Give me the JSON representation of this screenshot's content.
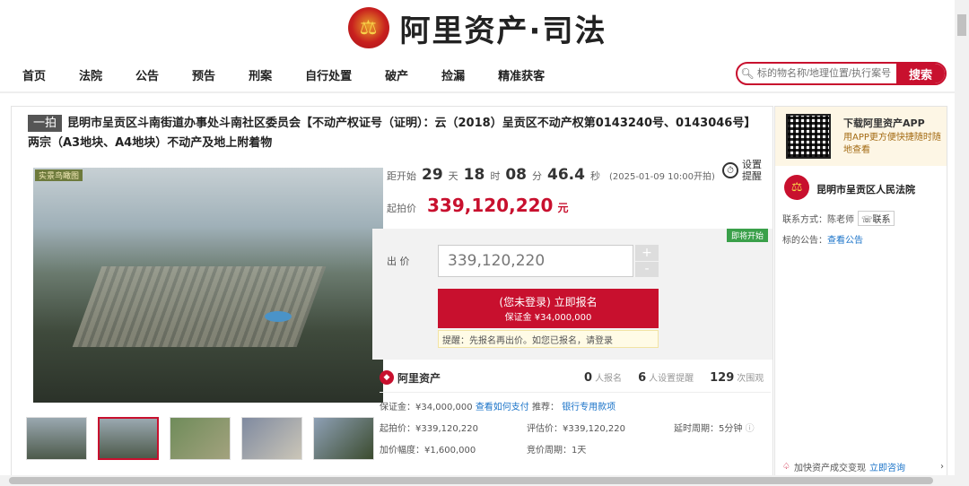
{
  "header": {
    "brand_icon": "scales-of-justice-emblem-icon",
    "brand_title": "阿里资产·司法"
  },
  "nav": {
    "items": [
      "首页",
      "法院",
      "公告",
      "预告",
      "刑案",
      "自行处置",
      "破产",
      "捡漏",
      "精准获客"
    ]
  },
  "search": {
    "placeholder": "标的物名称/地理位置/执行案号",
    "button_label": "搜索"
  },
  "item": {
    "tag": "一拍",
    "title": "昆明市呈贡区斗南街道办事处斗南社区委员会【不动产权证号（证明）：云（2018）呈贡区不动产权第0143240号、0143046号】两宗（A3地块、A4地块）不动产及地上附着物",
    "image_label": "实景鸟瞰图"
  },
  "countdown": {
    "label": "距开始",
    "days": "29",
    "days_unit": "天",
    "hours": "18",
    "hours_unit": "时",
    "minutes": "08",
    "minutes_unit": "分",
    "seconds": "46.4",
    "seconds_unit": "秒",
    "start_date": "(2025-01-09 10:00开拍)"
  },
  "reminder": {
    "label": "设置提醒"
  },
  "price": {
    "label": "起拍价",
    "value": "339,120,220",
    "unit": "元"
  },
  "bid": {
    "badge": "即将开始",
    "label": "出 价",
    "value": "339,120,220",
    "plus": "+",
    "minus": "-",
    "signup_main": "(您未登录) 立即报名",
    "signup_sub": "保证金 ¥34,000,000",
    "tip": "提醒：先报名再出价。如您已报名，请登录"
  },
  "stats": {
    "brand": "阿里资产",
    "signups": "0",
    "signups_label": "人报名",
    "reminders": "6",
    "reminders_label": "人设置提醒",
    "views": "129",
    "views_label": "次围观"
  },
  "details": {
    "deposit": "保证金：¥34,000,000",
    "how_to_pay": "查看如何支付",
    "recommend_label": "推荐：",
    "recommend_link": "银行专用款项",
    "start_price": "起拍价：¥339,120,220",
    "eval_price": "评估价：¥339,120,220",
    "delay": "延时周期：5分钟",
    "increment": "加价幅度：¥1,600,000",
    "cycle": "竞价周期：1天"
  },
  "sidebar": {
    "app_title": "下载阿里资产APP",
    "app_sub": "用APP更方便快捷随时随地查看",
    "court_name": "昆明市呈贡区人民法院",
    "contact_label": "联系方式：陈老师",
    "contact_btn": "联系",
    "notice_label": "标的公告：",
    "notice_link": "查看公告",
    "speedup": "加快资产成交变现",
    "speedup_link": "立即咨询"
  }
}
